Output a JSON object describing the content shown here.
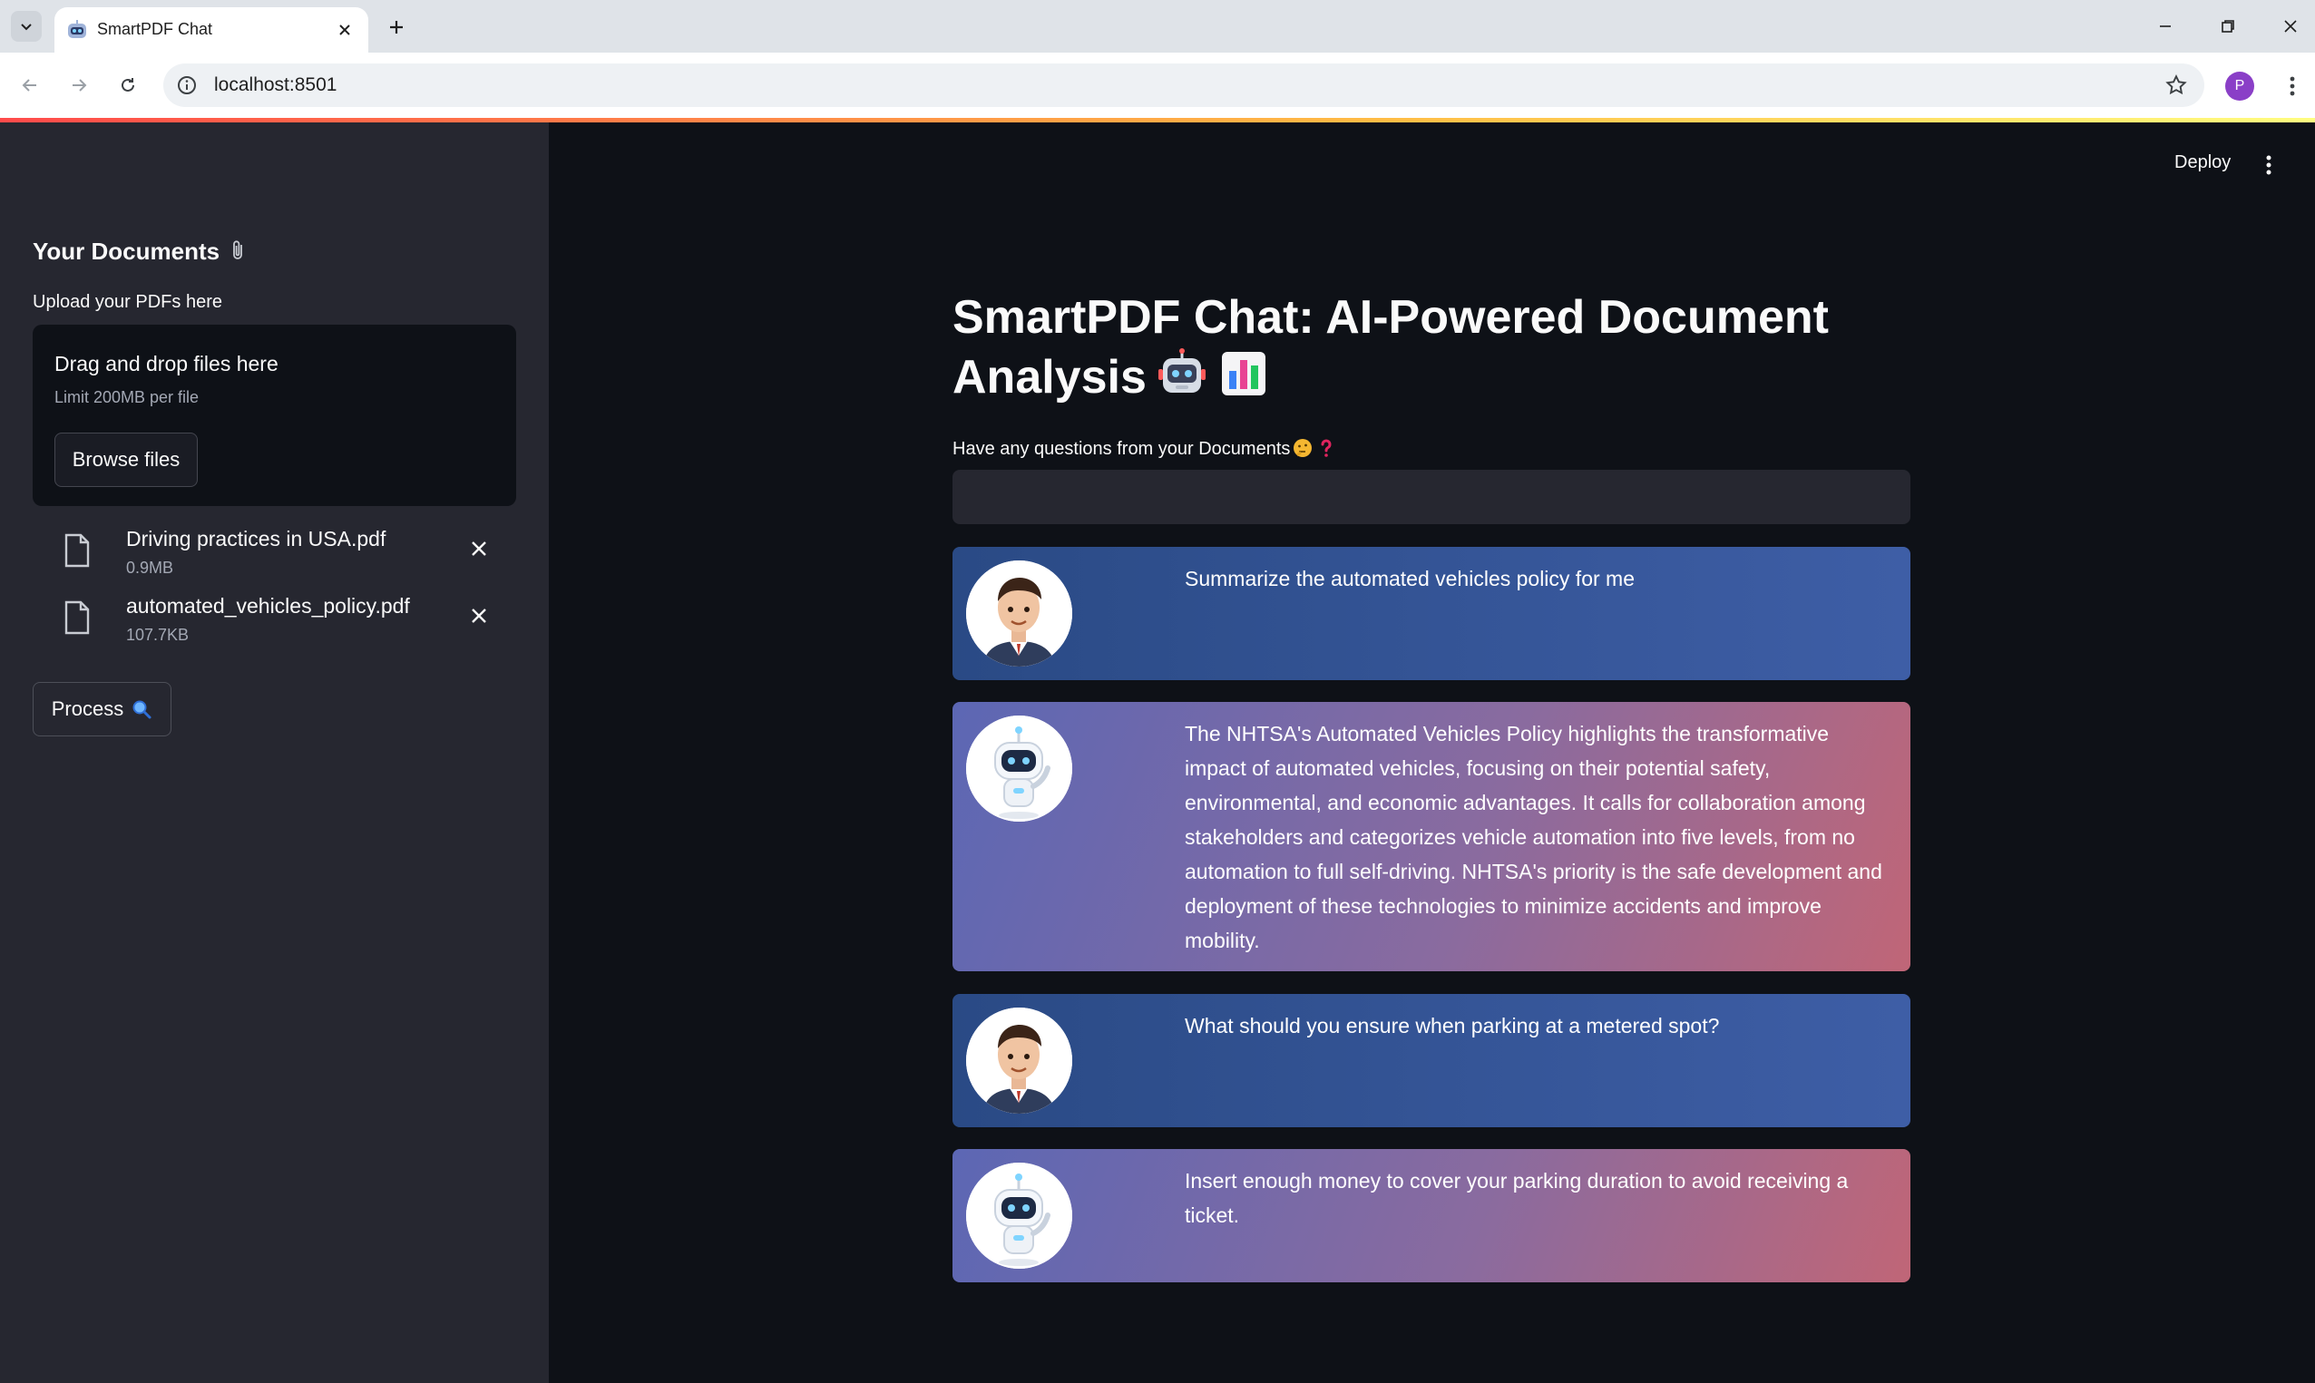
{
  "browser": {
    "tab_title": "SmartPDF Chat",
    "url": "localhost:8501",
    "profile_initial": "P"
  },
  "sidebar": {
    "title": "Your Documents",
    "upload_label": "Upload your PDFs here",
    "dropzone_title": "Drag and drop files here",
    "dropzone_limit": "Limit 200MB per file",
    "browse_label": "Browse files",
    "files": [
      {
        "name": "Driving practices in USA.pdf",
        "size": "0.9MB"
      },
      {
        "name": "automated_vehicles_policy.pdf",
        "size": "107.7KB"
      }
    ],
    "process_label": "Process"
  },
  "header": {
    "deploy_label": "Deploy"
  },
  "main": {
    "title": "SmartPDF Chat: AI-Powered Document Analysis",
    "question_label": "Have any questions from your Documents",
    "question_value": ""
  },
  "messages": [
    {
      "role": "user",
      "text": "Summarize the automated vehicles policy for me"
    },
    {
      "role": "bot",
      "text": "The NHTSA's Automated Vehicles Policy highlights the transformative impact of automated vehicles, focusing on their potential safety, environmental, and economic advantages. It calls for collaboration among stakeholders and categorizes vehicle automation into five levels, from no automation to full self-driving. NHTSA's priority is the safe development and deployment of these technologies to minimize accidents and improve mobility."
    },
    {
      "role": "user",
      "text": "What should you ensure when parking at a metered spot?"
    },
    {
      "role": "bot",
      "text": "Insert enough money to cover your parking duration to avoid receiving a ticket."
    }
  ],
  "colors": {
    "sidebar_bg": "#262730",
    "main_bg": "#0e1117",
    "user_message_bg": "#3e5ea6",
    "bot_message_gradient_start": "#5c67b4",
    "bot_message_gradient_end": "#c06677"
  }
}
